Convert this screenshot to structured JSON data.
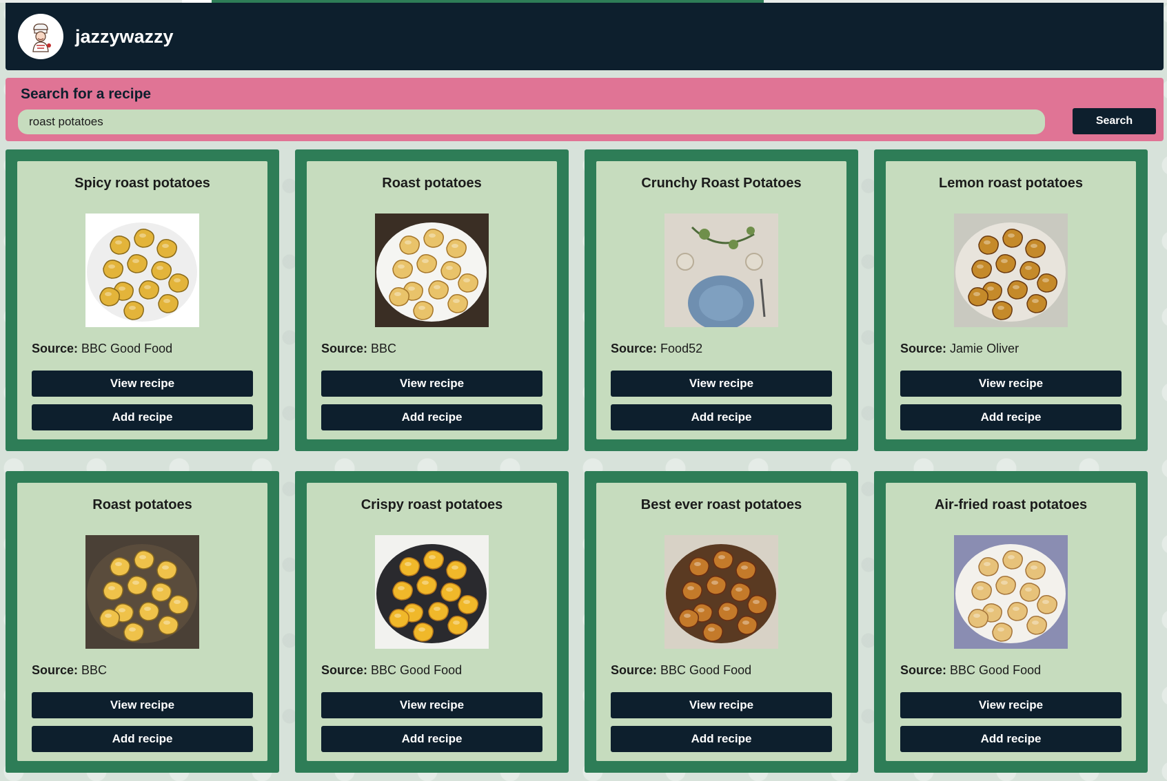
{
  "header": {
    "brand": "jazzywazzy",
    "progress_fraction": 0.47
  },
  "search": {
    "title": "Search for a recipe",
    "query": "roast potatoes",
    "button_label": "Search"
  },
  "labels": {
    "source": "Source:",
    "view": "View recipe",
    "add": "Add recipe"
  },
  "recipes": [
    {
      "title": "Spicy roast potatoes",
      "source": "BBC Good Food",
      "image": "spicy-roast-potatoes-photo"
    },
    {
      "title": "Roast potatoes",
      "source": "BBC",
      "image": "roast-potatoes-bowl-photo"
    },
    {
      "title": "Crunchy Roast Potatoes",
      "source": "Food52",
      "image": "table-setting-photo"
    },
    {
      "title": "Lemon roast potatoes",
      "source": "Jamie Oliver",
      "image": "lemon-roast-potatoes-photo"
    },
    {
      "title": "Roast potatoes",
      "source": "BBC",
      "image": "roast-potatoes-tray-photo"
    },
    {
      "title": "Crispy roast potatoes",
      "source": "BBC Good Food",
      "image": "crispy-roast-potatoes-photo"
    },
    {
      "title": "Best ever roast potatoes",
      "source": "BBC Good Food",
      "image": "best-ever-roast-potatoes-photo"
    },
    {
      "title": "Air-fried roast potatoes",
      "source": "BBC Good Food",
      "image": "air-fried-roast-potatoes-photo"
    }
  ],
  "colors": {
    "navy": "#0d1f2d",
    "green": "#2e7d57",
    "pink": "#e07495",
    "sage": "#c6dcbe"
  }
}
